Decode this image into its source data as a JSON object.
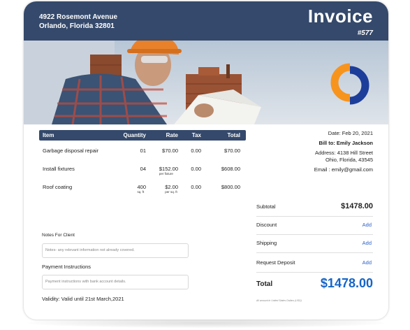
{
  "header": {
    "address_line1": "4922 Rosemont Avenue",
    "address_line2": "Orlando, Florida 32801",
    "title": "Invoice",
    "number": "#577",
    "bg_color": "#34496b"
  },
  "table": {
    "columns": [
      "Item",
      "Quantity",
      "Rate",
      "Tax",
      "Total"
    ],
    "rows": [
      {
        "item": "Garbage disposal repair",
        "qty": "01",
        "qty_unit": "",
        "rate": "$70.00",
        "rate_unit": "",
        "tax": "0.00",
        "total": "$70.00"
      },
      {
        "item": "Install fixtures",
        "qty": "04",
        "qty_unit": "",
        "rate": "$152.00",
        "rate_unit": "per fixture",
        "tax": "0.00",
        "total": "$608.00"
      },
      {
        "item": "Roof coating",
        "qty": "400",
        "qty_unit": "sq. ft",
        "rate": "$2.00",
        "rate_unit": "per sq. ft",
        "tax": "0.00",
        "total": "$800.00"
      }
    ]
  },
  "meta": {
    "date": "Date: Feb 20, 2021",
    "bill_to": "Bill to: Emily Jackson",
    "address1": "Address: 4138 Hill Street",
    "address2": "Ohio, Florida, 43545",
    "email": "Email : emily@gmail.com"
  },
  "notes": {
    "notes_label": "Notes For Client",
    "notes_placeholder": "Notes- any relevant information not already covered.",
    "payment_label": "Payment Instructions",
    "payment_placeholder": "Payment instructions with bank account details.",
    "validity": "Validity: Valid until 21st March,2021"
  },
  "summary": {
    "subtotal_label": "Subtotal",
    "subtotal_value": "$1478.00",
    "discount_label": "Discount",
    "shipping_label": "Shipping",
    "deposit_label": "Request Deposit",
    "add_label": "Add",
    "total_label": "Total",
    "total_value": "$1478.00",
    "footnote": "All amount in United States Dollars (USD)",
    "accent_color": "#1565c8"
  },
  "logo": {
    "icon": "interlocking-rings-logo",
    "colors": [
      "#f7941d",
      "#1d3d9a"
    ]
  }
}
